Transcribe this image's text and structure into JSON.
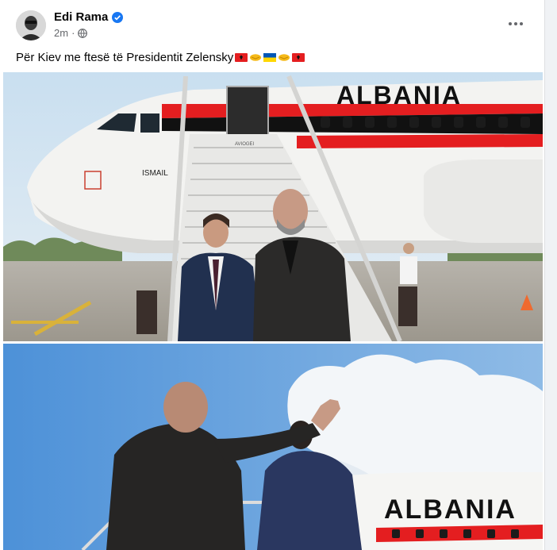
{
  "post": {
    "author": "Edi Rama",
    "time": "2m",
    "separator": "·",
    "caption_text": "Për Kiev me ftesë të Presidentit Zelensky",
    "caption_emojis": [
      "albania-flag",
      "handshake",
      "ukraine-flag",
      "handshake",
      "albania-flag"
    ]
  },
  "photos": {
    "top": {
      "livery_text": "ALBANIA",
      "plane_name": "ISMAIL",
      "stair_brand": "AVIOGEI"
    },
    "bottom": {
      "livery_text": "ALBANIA"
    }
  },
  "colors": {
    "verified_blue": "#1877f2",
    "albania_red": "#e41e20",
    "ukraine_blue": "#0057b7",
    "ukraine_yellow": "#ffd700",
    "meta_gray": "#65676b"
  },
  "icons": [
    "verified-badge-icon",
    "globe-icon",
    "more-options-icon"
  ]
}
